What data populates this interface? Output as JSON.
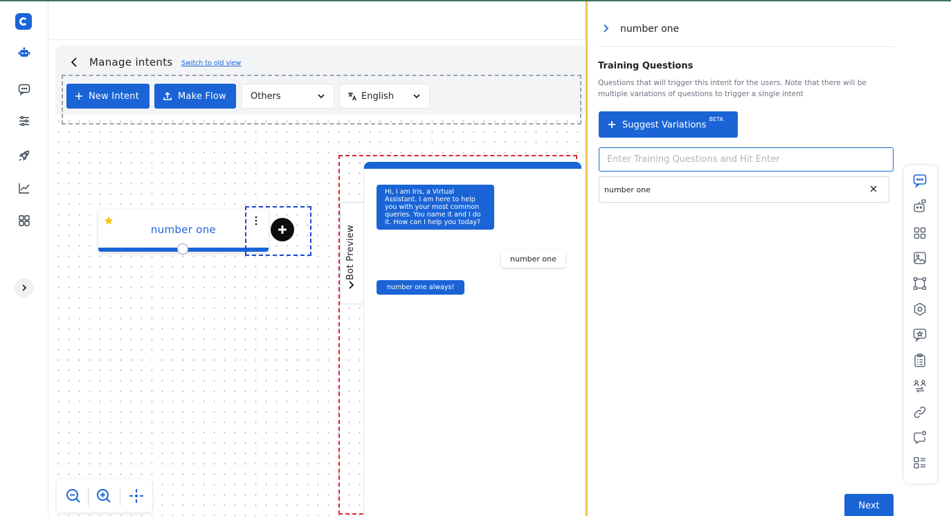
{
  "header": {
    "page_title": "Manage intents",
    "switch_link": "Switch to old view"
  },
  "toolbar": {
    "new_intent_label": "New Intent",
    "make_flow_label": "Make Flow",
    "category_value": "Others",
    "language_value": "English"
  },
  "sidebar": {
    "items": [
      {
        "icon": "bot-icon",
        "active": true
      },
      {
        "icon": "chat-icon"
      },
      {
        "icon": "sliders-icon"
      },
      {
        "icon": "rocket-icon"
      },
      {
        "icon": "analytics-icon"
      },
      {
        "icon": "grid-icon"
      }
    ]
  },
  "node": {
    "title": "number one"
  },
  "preview": {
    "tab_label": "Bot Preview",
    "bot_greeting": "Hi, I am Iris, a Virtual Assistant. I am here to help you with your most common queries. You name it and I do it. How can I help you today?",
    "user_message": "number one",
    "bot_reply": "number one always!"
  },
  "panel": {
    "title": "number one",
    "section_title": "Training Questions",
    "section_desc": "Questions that will trigger this intent for the users. Note that there will be multiple variations of questions to trigger a single intent",
    "suggest_label": "Suggest Variations",
    "suggest_badge": "BETA",
    "input_placeholder": "Enter Training Questions and Hit Enter",
    "questions": [
      "number one"
    ],
    "next_label": "Next"
  },
  "right_toolbar": {
    "icons": [
      "message-icon",
      "robot-icon",
      "grid-icon",
      "image-icon",
      "frame-icon",
      "settings-icon",
      "star-message-icon",
      "clipboard-icon",
      "users-switch-icon",
      "link-icon",
      "chat-alert-icon",
      "list-icon"
    ]
  },
  "colors": {
    "primary": "#1a64d6",
    "dash_grey": "#9ca3af",
    "dash_blue": "#1a44d6",
    "dash_red": "#e0242a",
    "divider": "#e8c65a"
  }
}
